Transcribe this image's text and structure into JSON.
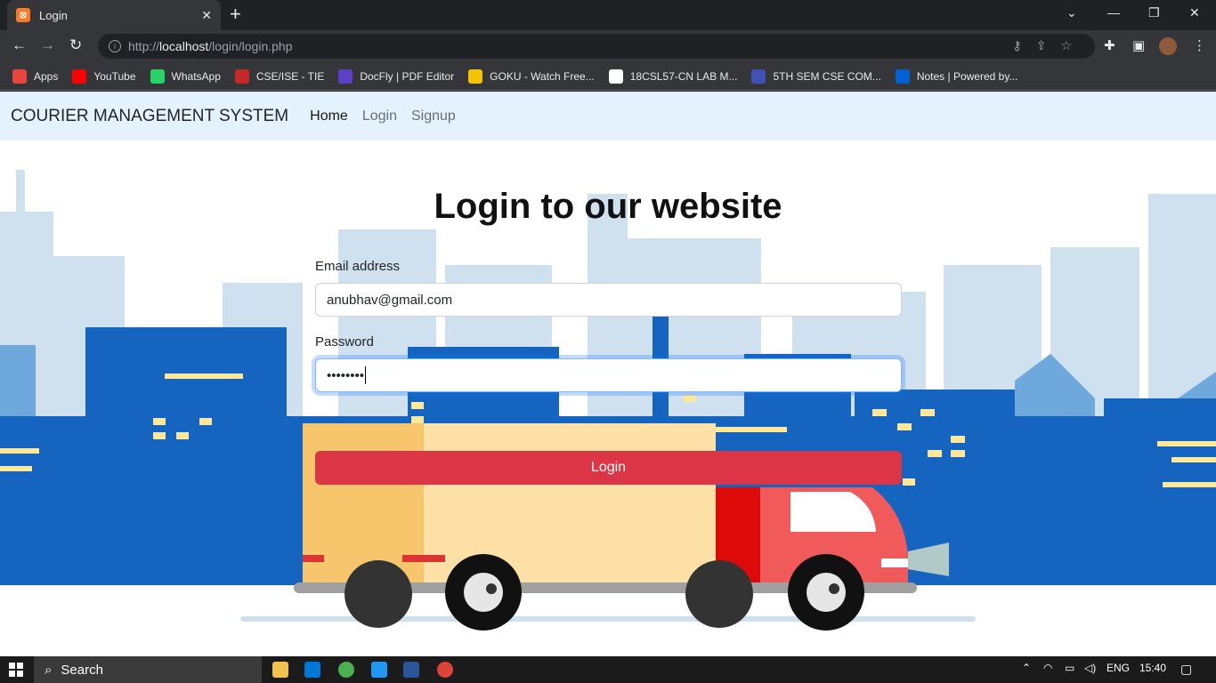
{
  "browser": {
    "tab_title": "Login",
    "tab_icon_letter": "⊠",
    "url_prefix": "http://",
    "url_host": "localhost",
    "url_path": "/login/login.php",
    "bookmarks": [
      {
        "label": "Apps",
        "color": "#e8453c",
        "icon": "apps-grid-icon"
      },
      {
        "label": "YouTube",
        "color": "#ff0000",
        "icon": "youtube-icon"
      },
      {
        "label": "WhatsApp",
        "color": "#25d366",
        "icon": "whatsapp-icon"
      },
      {
        "label": "CSE/ISE - TIE",
        "color": "#c62828",
        "icon": "chart-icon"
      },
      {
        "label": "DocFly | PDF Editor",
        "color": "#5b3fc4",
        "icon": "docfly-icon"
      },
      {
        "label": "GOKU - Watch Free...",
        "color": "#f5c400",
        "icon": "goku-icon"
      },
      {
        "label": "18CSL57-CN LAB M...",
        "color": "#ffffff",
        "icon": "globe-icon"
      },
      {
        "label": "5TH SEM CSE COM...",
        "color": "#3f51b5",
        "icon": "moon-icon"
      },
      {
        "label": "Notes | Powered by...",
        "color": "#0061d5",
        "icon": "box-icon"
      }
    ]
  },
  "navbar": {
    "brand": "COURIER MANAGEMENT SYSTEM",
    "links": [
      "Home",
      "Login",
      "Signup"
    ]
  },
  "form": {
    "heading": "Login to our website",
    "email_label": "Email address",
    "email_value": "anubhav@gmail.com",
    "password_label": "Password",
    "password_value": "••••••••",
    "submit_label": "Login"
  },
  "taskbar": {
    "search_placeholder": "Search",
    "language": "ENG",
    "time": "15:40"
  },
  "colors": {
    "navbar_bg": "#e3f2fd",
    "login_button": "#dc3545",
    "sky_blue": "#1565c0"
  }
}
